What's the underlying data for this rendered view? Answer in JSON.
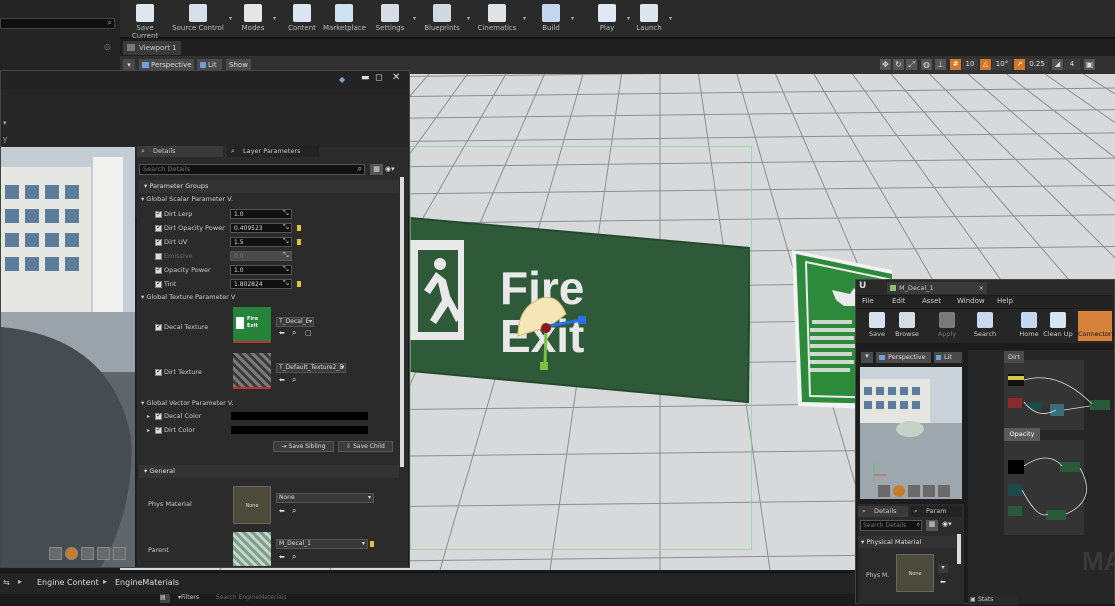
{
  "toolbar": {
    "buttons": [
      {
        "label": "Save Current",
        "icon": "save-icon"
      },
      {
        "label": "Source Control",
        "icon": "source-control-icon"
      },
      {
        "label": "Modes",
        "icon": "modes-icon"
      },
      {
        "label": "Content",
        "icon": "content-icon"
      },
      {
        "label": "Marketplace",
        "icon": "marketplace-icon"
      },
      {
        "label": "Settings",
        "icon": "settings-icon"
      },
      {
        "label": "Blueprints",
        "icon": "blueprints-icon"
      },
      {
        "label": "Cinematics",
        "icon": "cinematics-icon"
      },
      {
        "label": "Build",
        "icon": "build-icon"
      },
      {
        "label": "Play",
        "icon": "play-icon"
      },
      {
        "label": "Launch",
        "icon": "launch-icon"
      }
    ]
  },
  "viewport": {
    "tab_label": "Viewport 1",
    "perspective_label": "Perspective",
    "lit_label": "Lit",
    "show_label": "Show",
    "grid_snap": "10",
    "rotation_snap": "10°",
    "scale_snap": "0.25",
    "camera_speed": "4",
    "sign_text_line1": "Fire",
    "sign_text_line2": "Exit"
  },
  "material_window": {
    "tabs": {
      "details": "Details",
      "layer_parameters": "Layer Parameters"
    },
    "search_placeholder": "Search Details",
    "parameter_groups_label": "Parameter Groups",
    "global_scalar_label": "Global Scalar Parameter V.",
    "scalars": [
      {
        "name": "Dirt Lerp",
        "value": "1.0",
        "checked": true,
        "enabled": true
      },
      {
        "name": "Dirt Opacity Power",
        "value": "0.409523",
        "checked": true,
        "enabled": true
      },
      {
        "name": "Dirt UV",
        "value": "1.5",
        "checked": true,
        "enabled": true
      },
      {
        "name": "Emissive",
        "value": "0.0",
        "checked": false,
        "enabled": false
      },
      {
        "name": "Opacity Power",
        "value": "1.0",
        "checked": true,
        "enabled": true
      },
      {
        "name": "Tint",
        "value": "1.802824",
        "checked": true,
        "enabled": true
      }
    ],
    "global_texture_label": "Global Texture Parameter V",
    "decal_texture_label": "Decal Texture",
    "decal_texture_value": "T_Decal_E",
    "dirt_texture_label": "Dirt Texture",
    "dirt_texture_value": "T_Default_Texture2_D",
    "global_vector_label": "Global Vector Parameter V.",
    "decal_color_label": "Decal Color",
    "dirt_color_label": "Dirt Color",
    "save_sibling_label": "Save Sibling",
    "save_child_label": "Save Child",
    "general_label": "General",
    "phys_material_label": "Phys Material",
    "phys_material_value": "None",
    "phys_thumb_text": "None",
    "parent_label": "Parent",
    "parent_value": "M_Decal_1"
  },
  "asset_window": {
    "title": "M_Decal_1",
    "menu": [
      "File",
      "Edit",
      "Asset",
      "Window",
      "Help"
    ],
    "tools": [
      {
        "label": "Save",
        "icon": "save-icon"
      },
      {
        "label": "Browse",
        "icon": "browse-icon"
      },
      {
        "label": "Apply",
        "icon": "apply-icon"
      },
      {
        "label": "Search",
        "icon": "search-binoculars-icon"
      },
      {
        "label": "Home",
        "icon": "home-icon"
      },
      {
        "label": "Clean Up",
        "icon": "cleanup-icon"
      },
      {
        "label": "Connectors",
        "icon": "connectors-icon"
      }
    ],
    "perspective_label": "Perspective",
    "lit_label": "Lit",
    "dirt_comment": "Dirt",
    "opacity_comment": "Opacity",
    "details_tab": "Details",
    "param_tab": "Param",
    "search_placeholder": "Search Details",
    "physical_material_label": "Physical Material",
    "phys_label": "Phys M.",
    "phys_thumb_text": "None",
    "graph_watermark": "MA",
    "stats_label": "Stats"
  },
  "content_browser": {
    "breadcrumb": [
      "Engine Content",
      "EngineMaterials"
    ],
    "filters_label": "Filters",
    "search_placeholder": "Search EngineMaterials"
  }
}
